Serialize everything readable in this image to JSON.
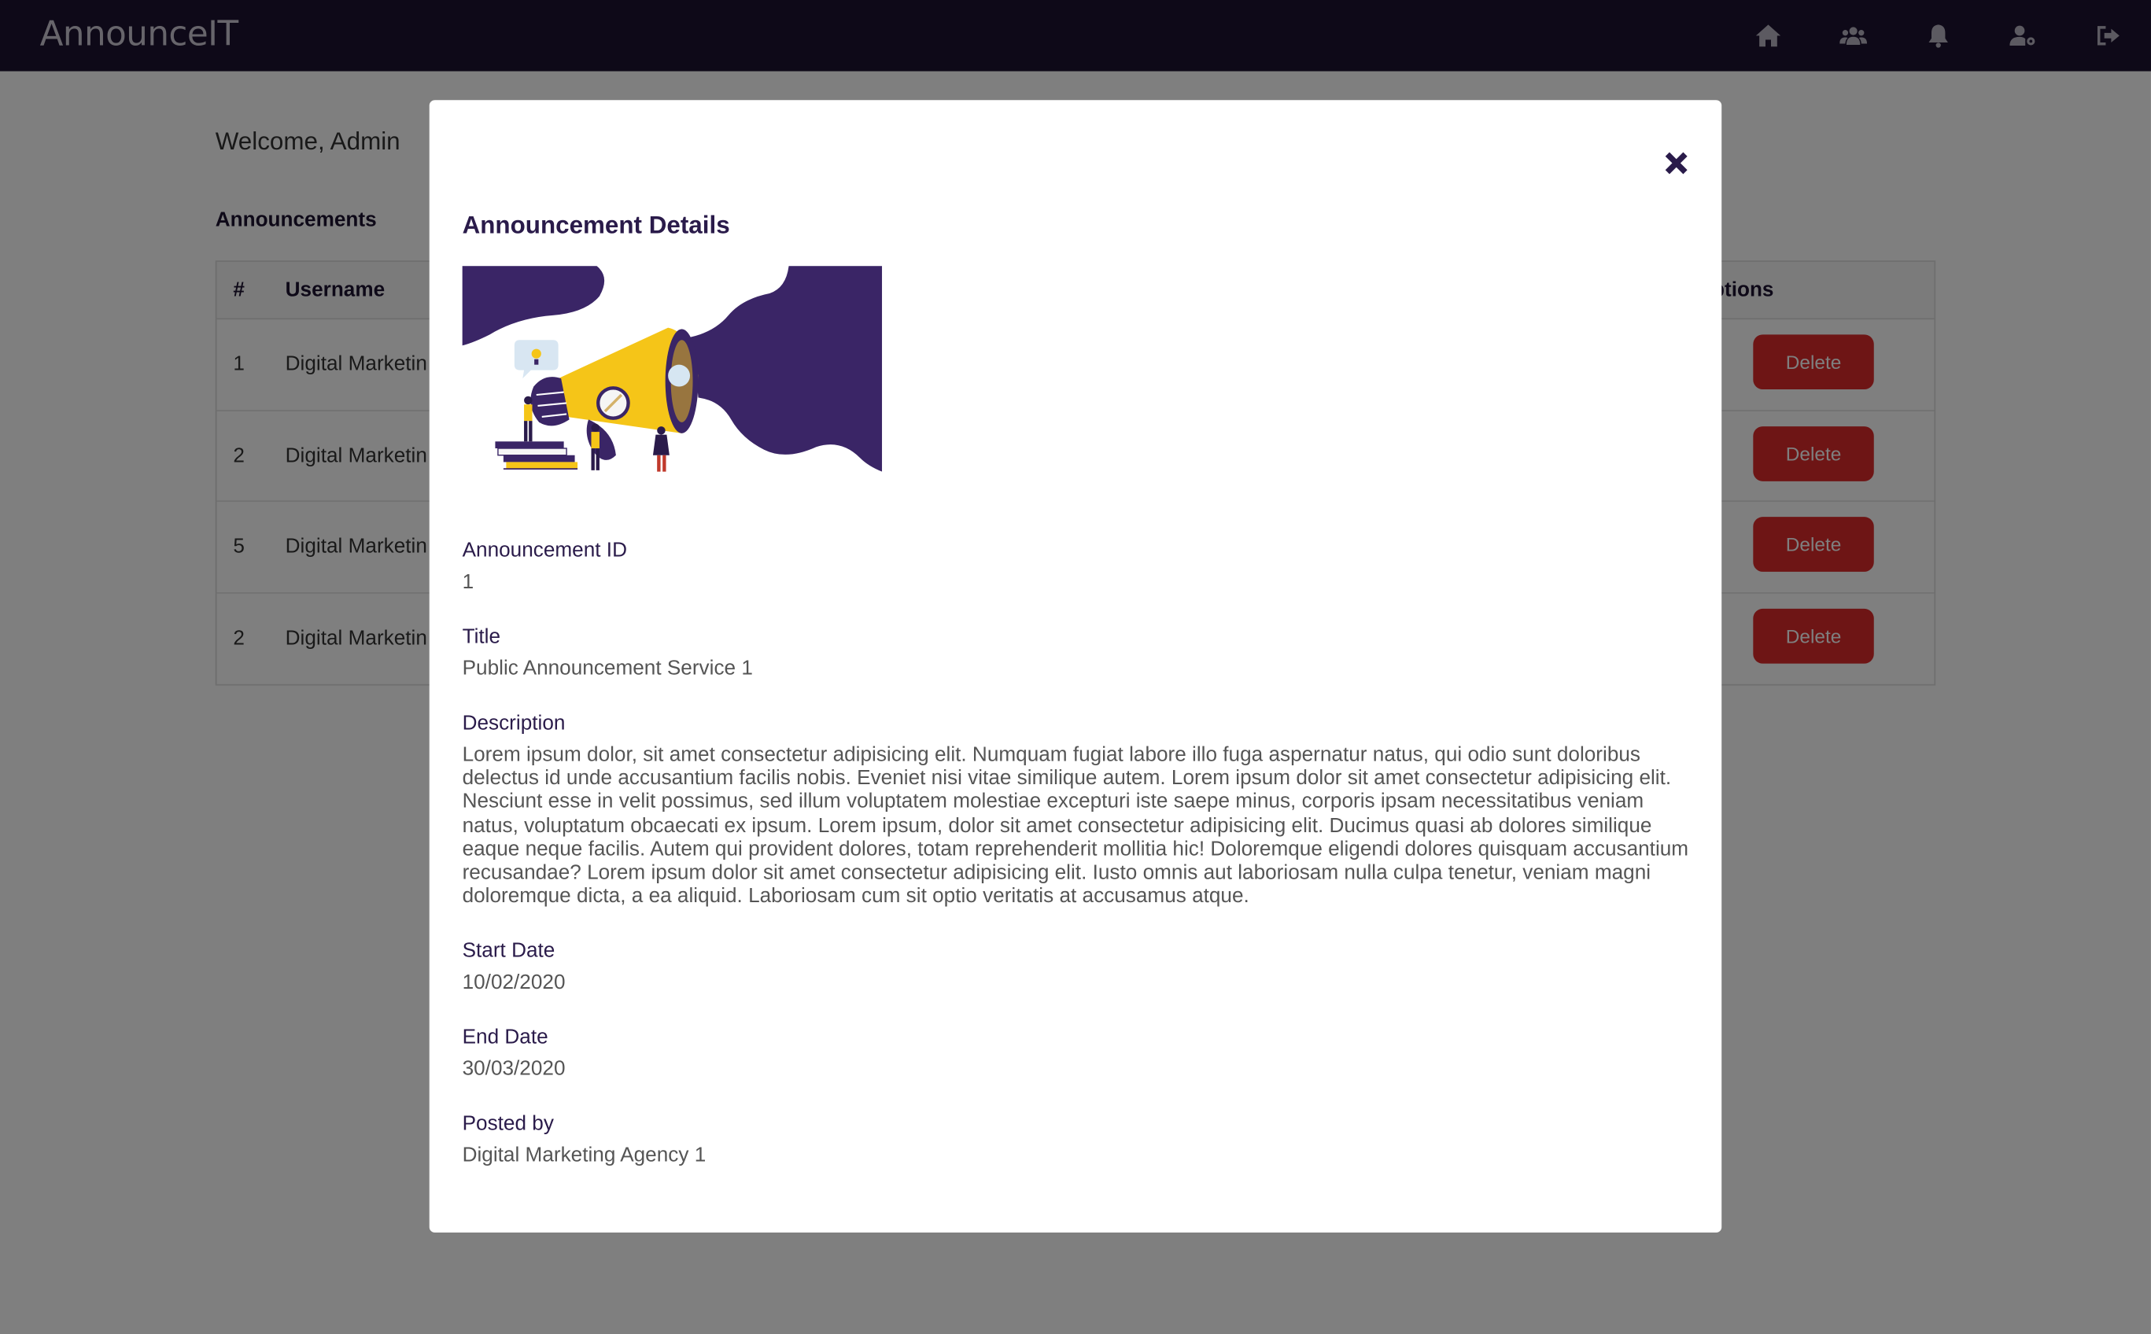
{
  "app": {
    "brand": "AnnounceIT"
  },
  "nav": {
    "icons": [
      "home-icon",
      "users-icon",
      "bell-icon",
      "user-settings-icon",
      "sign-out-icon"
    ]
  },
  "page": {
    "welcome": "Welcome, Admin",
    "section_title": "Announcements",
    "table": {
      "headers": {
        "num": "#",
        "username": "Username",
        "options": "ptions"
      },
      "rows": [
        {
          "num": "1",
          "username": "Digital Marketin",
          "action": "Delete"
        },
        {
          "num": "2",
          "username": "Digital Marketin",
          "action": "Delete"
        },
        {
          "num": "5",
          "username": "Digital Marketin",
          "action": "Delete"
        },
        {
          "num": "2",
          "username": "Digital Marketin",
          "action": "Delete"
        }
      ]
    }
  },
  "modal": {
    "title": "Announcement Details",
    "fields": {
      "id_label": "Announcement ID",
      "id_value": "1",
      "title_label": "Title",
      "title_value": "Public Announcement Service 1",
      "description_label": "Description",
      "description_value": "Lorem ipsum dolor, sit amet consectetur adipisicing elit. Numquam fugiat labore illo fuga aspernatur natus, qui odio sunt doloribus delectus id unde accusantium facilis nobis. Eveniet nisi vitae similique autem. Lorem ipsum dolor sit amet consectetur adipisicing elit. Nesciunt esse in velit possimus, sed illum voluptatem molestiae excepturi iste saepe minus, corporis ipsam necessitatibus veniam natus, voluptatum obcaecati ex ipsum. Lorem ipsum, dolor sit amet consectetur adipisicing elit. Ducimus quasi ab dolores similique eaque neque facilis. Autem qui provident dolores, totam reprehenderit mollitia hic! Doloremque eligendi dolores quisquam accusantium recusandae? Lorem ipsum dolor sit amet consectetur adipisicing elit. Iusto omnis aut laboriosam nulla culpa tenetur, veniam magni doloremque dicta, a ea aliquid. Laboriosam cum sit optio veritatis at accusamus atque.",
      "start_label": "Start Date",
      "start_value": "10/02/2020",
      "end_label": "End Date",
      "end_value": "30/03/2020",
      "posted_label": "Posted by",
      "posted_value": "Digital Marketing Agency 1"
    },
    "close_icon": "close-icon",
    "illustration": "megaphone-illustration"
  },
  "colors": {
    "navbar": "#1d1230",
    "accent": "#2a1b4a",
    "delete": "#dc2b2b",
    "megaphone": "#f5c518"
  }
}
